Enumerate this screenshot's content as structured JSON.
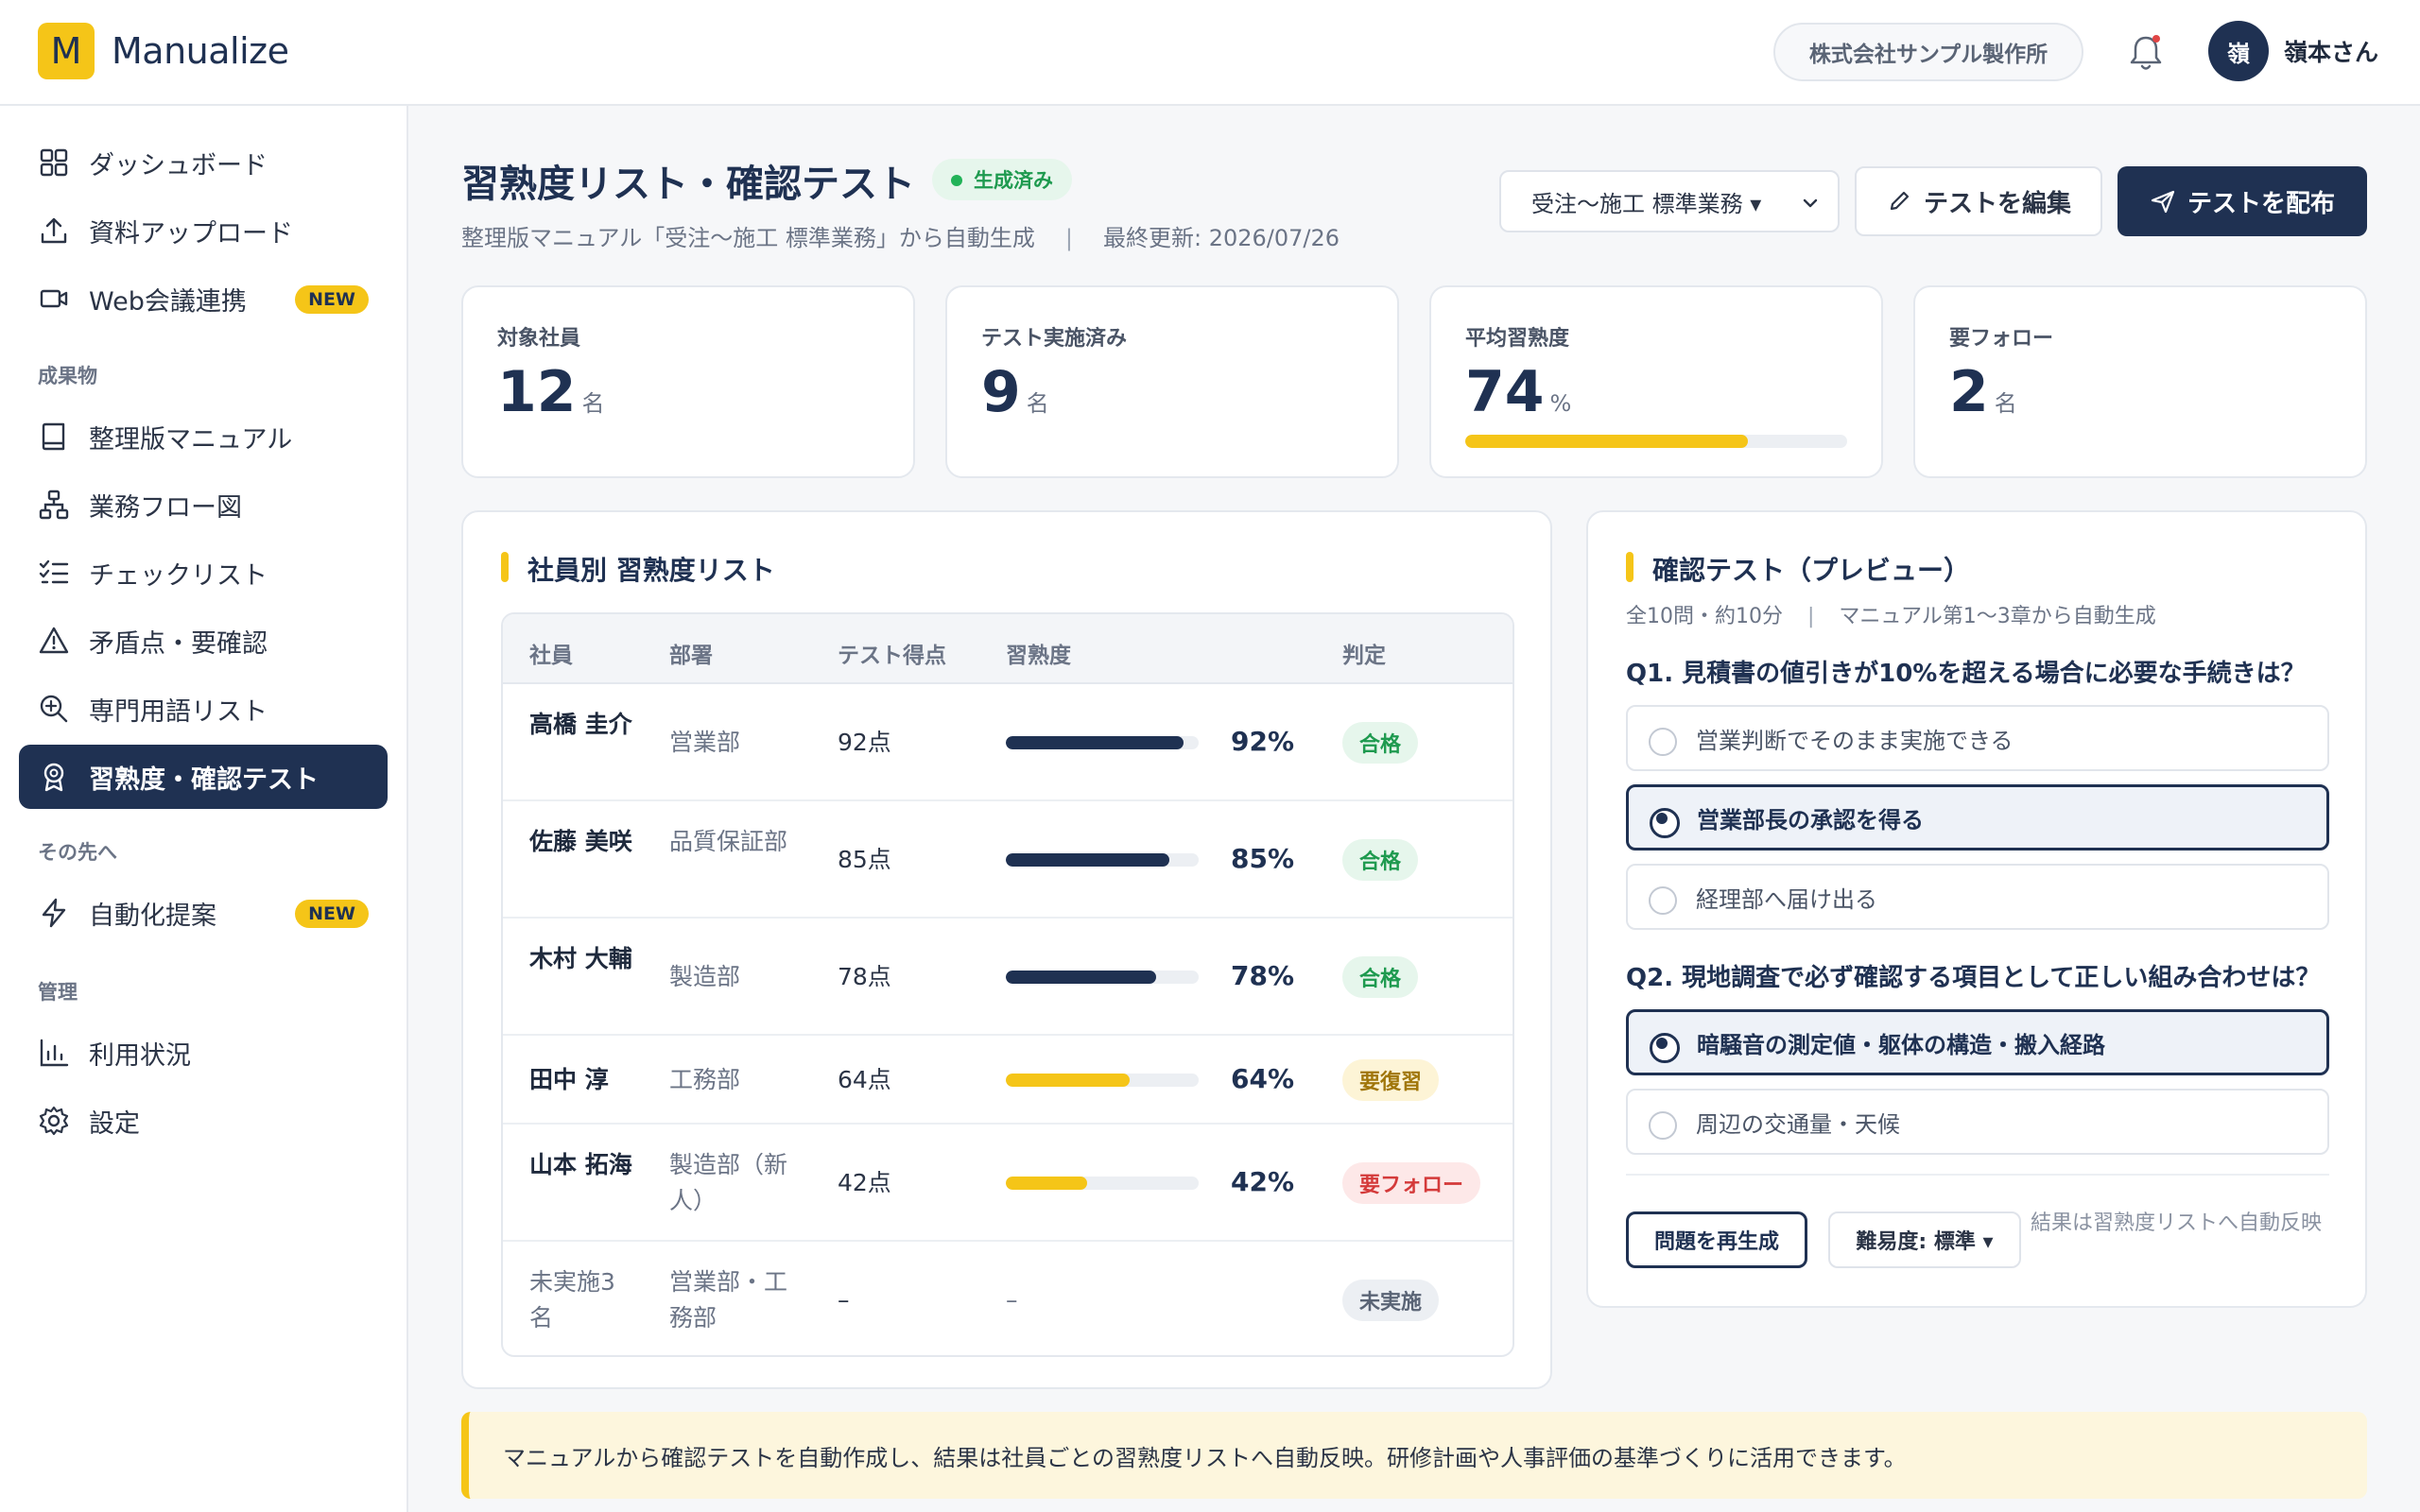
{
  "app": {
    "logo_letter": "M",
    "name": "Manualize"
  },
  "header": {
    "company": "株式会社サンプル製作所",
    "avatar_initial": "嶺",
    "user_name": "嶺本さん"
  },
  "sidebar": {
    "items": [
      {
        "label": "ダッシュボード",
        "icon": "dashboard-icon"
      },
      {
        "label": "資料アップロード",
        "icon": "upload-icon"
      },
      {
        "label": "Web会議連携",
        "icon": "video-icon",
        "badge": "NEW"
      }
    ],
    "section_outputs": "成果物",
    "outputs": [
      {
        "label": "整理版マニュアル",
        "icon": "book-icon"
      },
      {
        "label": "業務フロー図",
        "icon": "flow-icon"
      },
      {
        "label": "チェックリスト",
        "icon": "checklist-icon"
      },
      {
        "label": "矛盾点・要確認",
        "icon": "warning-icon"
      },
      {
        "label": "専門用語リスト",
        "icon": "search-icon"
      },
      {
        "label": "習熟度・確認テスト",
        "icon": "award-icon",
        "active": true
      }
    ],
    "section_beyond": "その先へ",
    "beyond": [
      {
        "label": "自動化提案",
        "icon": "bolt-icon",
        "badge": "NEW"
      }
    ],
    "section_admin": "管理",
    "admin": [
      {
        "label": "利用状況",
        "icon": "chart-icon"
      },
      {
        "label": "設定",
        "icon": "gear-icon"
      }
    ]
  },
  "page": {
    "title": "習熟度リスト・確認テスト",
    "status": "生成済み",
    "source": "整理版マニュアル「受注〜施工 標準業務」から自動生成",
    "updated": "最終更新: 2026/07/26",
    "manual_select": "受注〜施工 標準業務 ▾",
    "edit_button": "テストを編集",
    "send_button": "テストを配布"
  },
  "stats": [
    {
      "label": "対象社員",
      "value": "12",
      "unit": "名"
    },
    {
      "label": "テスト実施済み",
      "value": "9",
      "unit": "名"
    },
    {
      "label": "平均習熟度",
      "value": "74",
      "unit": "%",
      "progress": 0.74
    },
    {
      "label": "要フォロー",
      "value": "2",
      "unit": "名"
    }
  ],
  "employee_table": {
    "title": "社員別 習熟度リスト",
    "headers": [
      "社員",
      "部署",
      "テスト得点",
      "習熟度",
      "判定"
    ],
    "rows": [
      {
        "name": "高橋 圭介",
        "dept": "営業部",
        "score": "92点",
        "pct": "92%",
        "level": 0.92,
        "bar_color": "#1f3152",
        "status": "合格",
        "status_kind": "pass"
      },
      {
        "name": "佐藤 美咲",
        "dept": "品質保証部",
        "score": "85点",
        "pct": "85%",
        "level": 0.85,
        "bar_color": "#1f3152",
        "status": "合格",
        "status_kind": "pass"
      },
      {
        "name": "木村 大輔",
        "dept": "製造部",
        "score": "78点",
        "pct": "78%",
        "level": 0.78,
        "bar_color": "#1f3152",
        "status": "合格",
        "status_kind": "pass"
      },
      {
        "name": "田中 淳",
        "dept": "工務部",
        "score": "64点",
        "pct": "64%",
        "level": 0.64,
        "bar_color": "#f5c518",
        "status": "要復習",
        "status_kind": "review"
      },
      {
        "name": "山本 拓海",
        "dept": "製造部（新人）",
        "score": "42点",
        "pct": "42%",
        "level": 0.42,
        "bar_color": "#f5c518",
        "status": "要フォロー",
        "status_kind": "follow"
      },
      {
        "name": "未実施3名",
        "dept": "営業部・工務部",
        "score": "–",
        "dash": "–",
        "status": "未実施",
        "status_kind": "none"
      }
    ]
  },
  "quiz": {
    "title": "確認テスト（プレビュー）",
    "meta": "全10問・約10分",
    "meta_source": "マニュアル第1〜3章から自動生成",
    "questions": [
      {
        "q": "Q1. 見積書の値引きが10%を超える場合に必要な手続きは？",
        "options": [
          "営業判断でそのまま実施できる",
          "営業部長の承認を得る",
          "経理部へ届け出る"
        ],
        "selected": 1
      },
      {
        "q": "Q2. 現地調査で必ず確認する項目として正しい組み合わせは？",
        "options": [
          "暗騒音の測定値・躯体の構造・搬入経路",
          "周辺の交通量・天候"
        ],
        "selected": 0
      }
    ],
    "regen_button": "問題を再生成",
    "difficulty": "難易度: 標準 ▾",
    "note": "結果は習熟度リストへ自動反映"
  },
  "banner": "マニュアルから確認テストを自動作成し、結果は社員ごとの習熟度リストへ自動反映。研修計画や人事評価の基準づくりに活用できます。",
  "colors": {
    "navy": "#1f3152",
    "accent": "#f5c518",
    "pass": "#1e9a4f",
    "review": "#b8860b",
    "follow": "#d43a3a"
  }
}
